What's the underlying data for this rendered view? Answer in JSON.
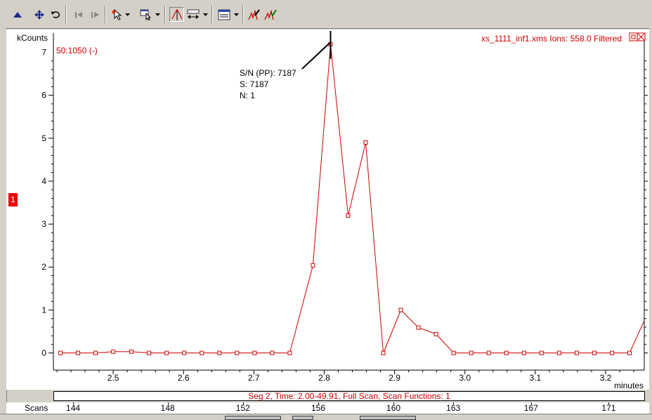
{
  "toolbar": {
    "icons": [
      "arrow-up-icon",
      "move-cross-icon",
      "undo-icon",
      "back-icon",
      "forward-icon",
      "pointer-star-icon",
      "select-pointer-icon",
      "peak-cursor-icon",
      "expand-icon",
      "display-options-icon",
      "peak-edit-icon",
      "peak-check-icon"
    ]
  },
  "chart_data": {
    "type": "line",
    "title": "xs_1111_inf1.xms Ions: 558.0 Filtered",
    "trace_label": "50:1050 (-)",
    "ylabel": "kCounts",
    "xlabel": "minutes",
    "ylim": [
      -0.4,
      7.45
    ],
    "xlim": [
      2.415,
      3.255
    ],
    "y_ticks": [
      "0",
      "1",
      "2",
      "3",
      "4",
      "5",
      "6",
      "7"
    ],
    "x_ticks": [
      "2.5",
      "2.6",
      "2.7",
      "2.8",
      "2.9",
      "3.0",
      "3.1",
      "3.2"
    ],
    "series": [
      {
        "color": "#cc0000",
        "x": [
          2.425,
          2.45,
          2.475,
          2.5,
          2.526,
          2.551,
          2.576,
          2.601,
          2.626,
          2.651,
          2.676,
          2.701,
          2.726,
          2.751,
          2.784,
          2.809,
          2.834,
          2.859,
          2.884,
          2.909,
          2.934,
          2.959,
          2.984,
          3.009,
          3.034,
          3.059,
          3.084,
          3.109,
          3.134,
          3.159,
          3.184,
          3.209,
          3.234,
          3.255
        ],
        "y": [
          0.0,
          0.0,
          0.0,
          0.03,
          0.03,
          0.0,
          0.0,
          0.0,
          0.0,
          0.0,
          0.0,
          0.0,
          0.0,
          0.0,
          2.04,
          7.19,
          3.2,
          4.9,
          0.0,
          1.0,
          0.59,
          0.44,
          0.0,
          0.0,
          0.0,
          0.0,
          0.0,
          0.0,
          0.0,
          0.0,
          0.0,
          0.0,
          0.0,
          0.75
        ]
      }
    ],
    "annotation": {
      "peak_x": 2.809,
      "lines": [
        "S/N (PP): 7187",
        "S: 7187",
        "N: 1"
      ]
    },
    "channel_marker": "1",
    "segment_info": "Seg 2, Time: 2.00-49.91, Full Scan, Scan Functions: 1",
    "scans_label": "Scans",
    "scans": [
      {
        "x": 2.443,
        "label": "144"
      },
      {
        "x": 2.5775,
        "label": "148"
      },
      {
        "x": 2.6845,
        "label": "152"
      },
      {
        "x": 2.7915,
        "label": "156"
      },
      {
        "x": 2.8985,
        "label": "160"
      },
      {
        "x": 2.9835,
        "label": "163"
      },
      {
        "x": 3.094,
        "label": "167"
      },
      {
        "x": 3.2045,
        "label": "171"
      }
    ]
  }
}
